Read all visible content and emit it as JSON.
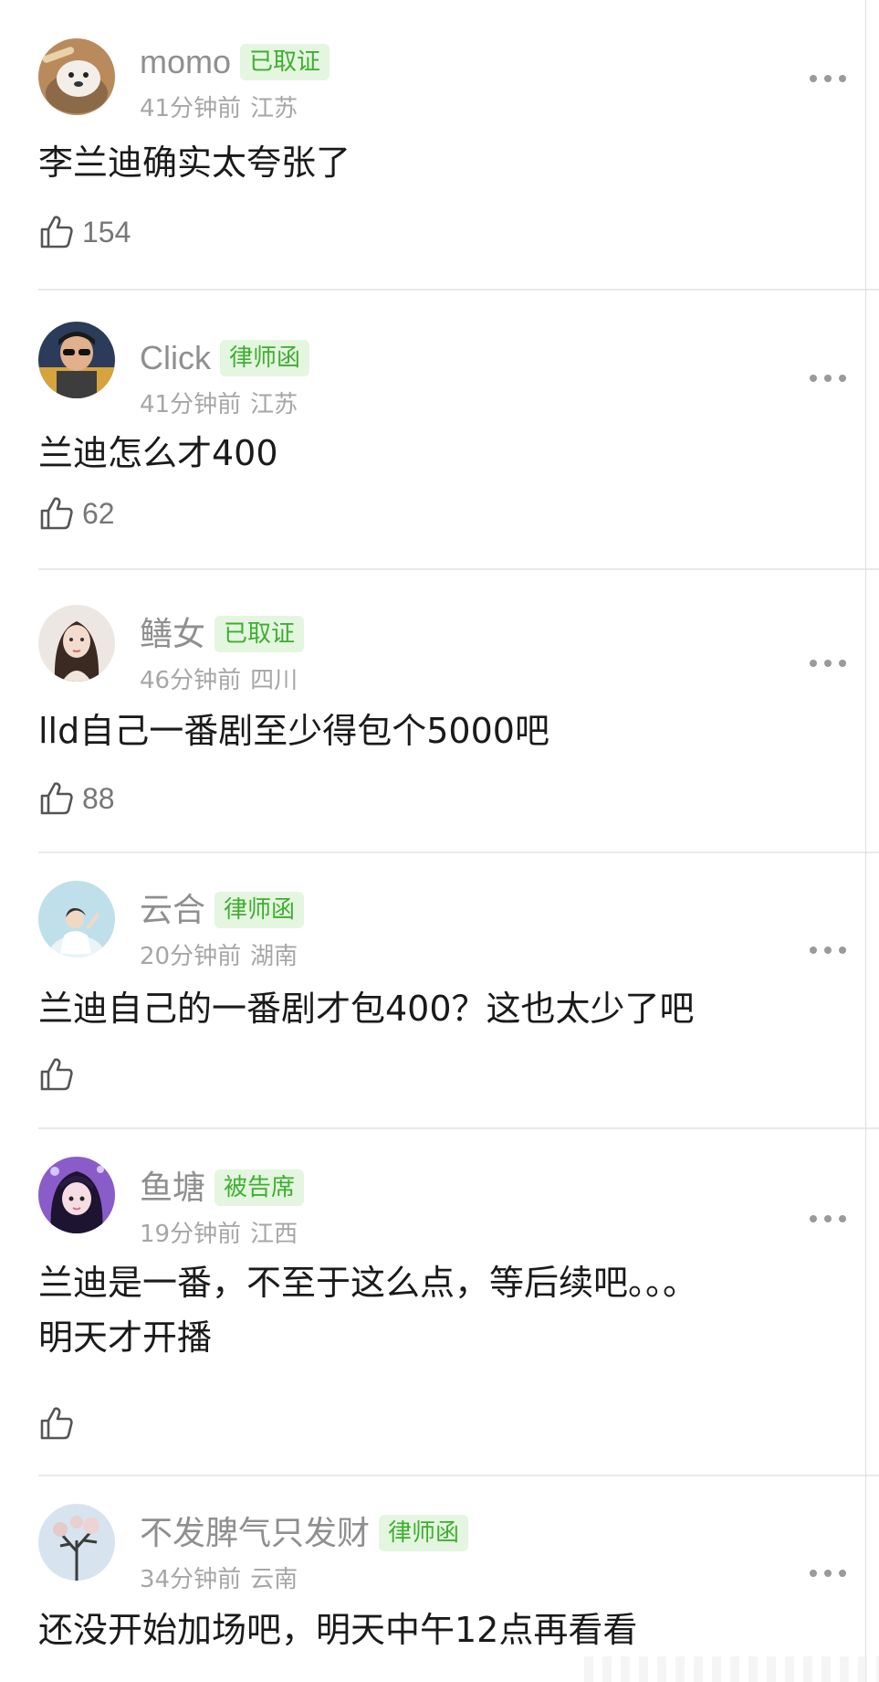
{
  "comments": [
    {
      "username": "momo",
      "badge": "已取证",
      "time": "41分钟前",
      "location": "江苏",
      "text": "李兰迪确实太夸张了",
      "likes": "154",
      "avatar": "avatar-dog"
    },
    {
      "username": "Click",
      "badge": "律师函",
      "time": "41分钟前",
      "location": "江苏",
      "text": "兰迪怎么才400",
      "likes": "62",
      "avatar": "avatar-man-sunglasses"
    },
    {
      "username": "鳝女",
      "badge": "已取证",
      "time": "46分钟前",
      "location": "四川",
      "text": "lld自己一番剧至少得包个5000吧",
      "likes": "88",
      "avatar": "avatar-woman"
    },
    {
      "username": "云合",
      "badge": "律师函",
      "time": "20分钟前",
      "location": "湖南",
      "text": "兰迪自己的一番剧才包400？这也太少了吧",
      "likes": "",
      "avatar": "avatar-sky-girl"
    },
    {
      "username": "鱼塘",
      "badge": "被告席",
      "time": "19分钟前",
      "location": "江西",
      "text": "兰迪是一番，不至于这么点，等后续吧。。。\n明天才开播",
      "likes": "",
      "avatar": "avatar-purple-girl"
    },
    {
      "username": "不发脾气只发财",
      "badge": "律师函",
      "time": "34分钟前",
      "location": "云南",
      "text": "还没开始加场吧，明天中午12点再看看",
      "likes": "",
      "avatar": "avatar-tree"
    }
  ],
  "icons": {
    "like": "thumbs-up-icon",
    "more": "more-dots-icon"
  },
  "colors": {
    "badge_bg": "#e4f6df",
    "badge_text": "#3fae32",
    "username": "#8f8f8f",
    "meta": "#a6a6a6",
    "body_text": "#1a1a1a"
  }
}
